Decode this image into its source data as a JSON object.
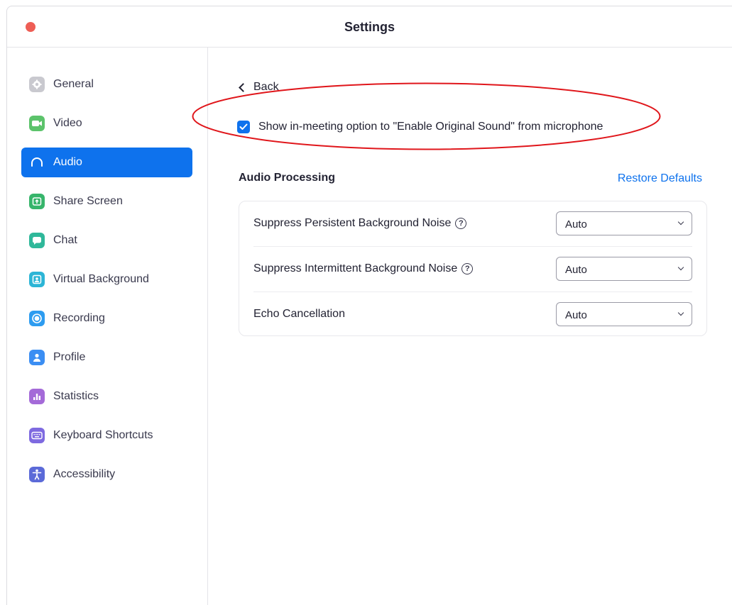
{
  "window": {
    "title": "Settings"
  },
  "sidebar": {
    "items": [
      {
        "label": "General",
        "icon": "gear-icon",
        "color": "#c9c9cf",
        "active": false
      },
      {
        "label": "Video",
        "icon": "video-camera-icon",
        "color": "#5cc36b",
        "active": false
      },
      {
        "label": "Audio",
        "icon": "headphones-icon",
        "color": "#ffffff",
        "active": true
      },
      {
        "label": "Share Screen",
        "icon": "share-screen-icon",
        "color": "#37b56b",
        "active": false
      },
      {
        "label": "Chat",
        "icon": "chat-bubble-icon",
        "color": "#2fb89a",
        "active": false
      },
      {
        "label": "Virtual Background",
        "icon": "virtual-background-icon",
        "color": "#2cb5d6",
        "active": false
      },
      {
        "label": "Recording",
        "icon": "recording-icon",
        "color": "#2d9cf0",
        "active": false
      },
      {
        "label": "Profile",
        "icon": "profile-icon",
        "color": "#3b8ef3",
        "active": false
      },
      {
        "label": "Statistics",
        "icon": "statistics-icon",
        "color": "#a46ad8",
        "active": false
      },
      {
        "label": "Keyboard Shortcuts",
        "icon": "keyboard-icon",
        "color": "#7e6ae0",
        "active": false
      },
      {
        "label": "Accessibility",
        "icon": "accessibility-icon",
        "color": "#5b6ad8",
        "active": false
      }
    ]
  },
  "main": {
    "back_label": "Back",
    "original_sound_option": {
      "label": "Show in-meeting option to \"Enable Original Sound\" from microphone",
      "checked": true
    },
    "section_title": "Audio Processing",
    "restore_defaults": "Restore Defaults",
    "settings": [
      {
        "label": "Suppress Persistent Background Noise",
        "help": true,
        "value": "Auto"
      },
      {
        "label": "Suppress Intermittent Background Noise",
        "help": true,
        "value": "Auto"
      },
      {
        "label": "Echo Cancellation",
        "help": false,
        "value": "Auto"
      }
    ]
  },
  "colors": {
    "accent": "#0e72ed",
    "annotation": "#e0161b",
    "close_button": "#ee5e55"
  }
}
